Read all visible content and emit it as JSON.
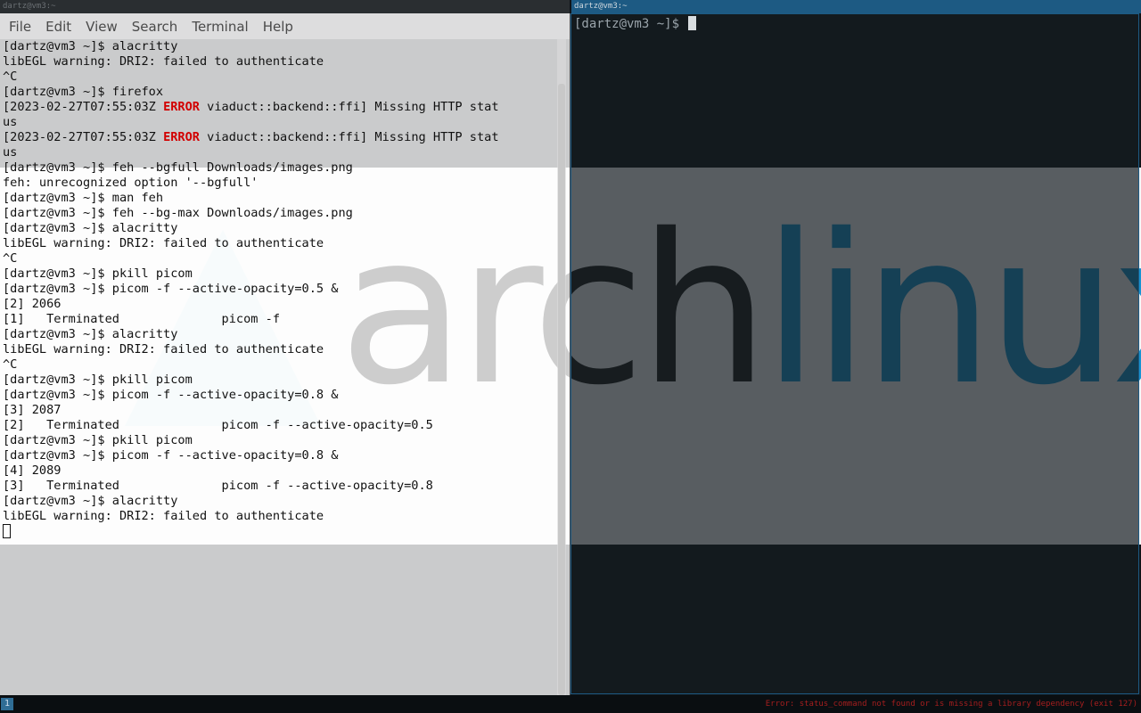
{
  "wallpaper": {
    "logo_arch": "arch",
    "logo_linux": "linux"
  },
  "left_window": {
    "title": "dartz@vm3:~",
    "menu": [
      "File",
      "Edit",
      "View",
      "Search",
      "Terminal",
      "Help"
    ],
    "lines": [
      [
        {
          "t": "[dartz@vm3 ~]$ alacritty"
        }
      ],
      [
        {
          "t": "libEGL warning: DRI2: failed to authenticate"
        }
      ],
      [
        {
          "t": "^C"
        }
      ],
      [
        {
          "t": "[dartz@vm3 ~]$ firefox"
        }
      ],
      [
        {
          "t": "[2023-02-27T07:55:03Z "
        },
        {
          "t": "ERROR",
          "err": true
        },
        {
          "t": " viaduct::backend::ffi] Missing HTTP stat"
        }
      ],
      [
        {
          "t": "us"
        }
      ],
      [
        {
          "t": "[2023-02-27T07:55:03Z "
        },
        {
          "t": "ERROR",
          "err": true
        },
        {
          "t": " viaduct::backend::ffi] Missing HTTP stat"
        }
      ],
      [
        {
          "t": "us"
        }
      ],
      [
        {
          "t": "[dartz@vm3 ~]$ feh --bgfull Downloads/images.png"
        }
      ],
      [
        {
          "t": "feh: unrecognized option '--bgfull'"
        }
      ],
      [
        {
          "t": "[dartz@vm3 ~]$ man feh"
        }
      ],
      [
        {
          "t": "[dartz@vm3 ~]$ feh --bg-max Downloads/images.png"
        }
      ],
      [
        {
          "t": "[dartz@vm3 ~]$ alacritty"
        }
      ],
      [
        {
          "t": "libEGL warning: DRI2: failed to authenticate"
        }
      ],
      [
        {
          "t": "^C"
        }
      ],
      [
        {
          "t": "[dartz@vm3 ~]$ pkill picom"
        }
      ],
      [
        {
          "t": "[dartz@vm3 ~]$ picom -f --active-opacity=0.5 &"
        }
      ],
      [
        {
          "t": "[2] 2066"
        }
      ],
      [
        {
          "t": "[1]   Terminated              picom -f"
        }
      ],
      [
        {
          "t": "[dartz@vm3 ~]$ alacritty"
        }
      ],
      [
        {
          "t": "libEGL warning: DRI2: failed to authenticate"
        }
      ],
      [
        {
          "t": "^C"
        }
      ],
      [
        {
          "t": "[dartz@vm3 ~]$ pkill picom"
        }
      ],
      [
        {
          "t": "[dartz@vm3 ~]$ picom -f --active-opacity=0.8 &"
        }
      ],
      [
        {
          "t": "[3] 2087"
        }
      ],
      [
        {
          "t": "[2]   Terminated              picom -f --active-opacity=0.5"
        }
      ],
      [
        {
          "t": "[dartz@vm3 ~]$ pkill picom"
        }
      ],
      [
        {
          "t": "[dartz@vm3 ~]$ picom -f --active-opacity=0.8 &"
        }
      ],
      [
        {
          "t": "[4] 2089"
        }
      ],
      [
        {
          "t": "[3]   Terminated              picom -f --active-opacity=0.8"
        }
      ],
      [
        {
          "t": "[dartz@vm3 ~]$ alacritty"
        }
      ],
      [
        {
          "t": "libEGL warning: DRI2: failed to authenticate"
        }
      ]
    ]
  },
  "right_window": {
    "title": "dartz@vm3:~",
    "prompt": "[dartz@vm3 ~]$ "
  },
  "statusbar": {
    "workspace": "1",
    "error_text": "Error: status_command not found or is missing a library dependency (exit 127)"
  },
  "colors": {
    "error_red": "#d20000",
    "focus_border": "#1d5a83",
    "arch_blue": "#1793d1"
  }
}
